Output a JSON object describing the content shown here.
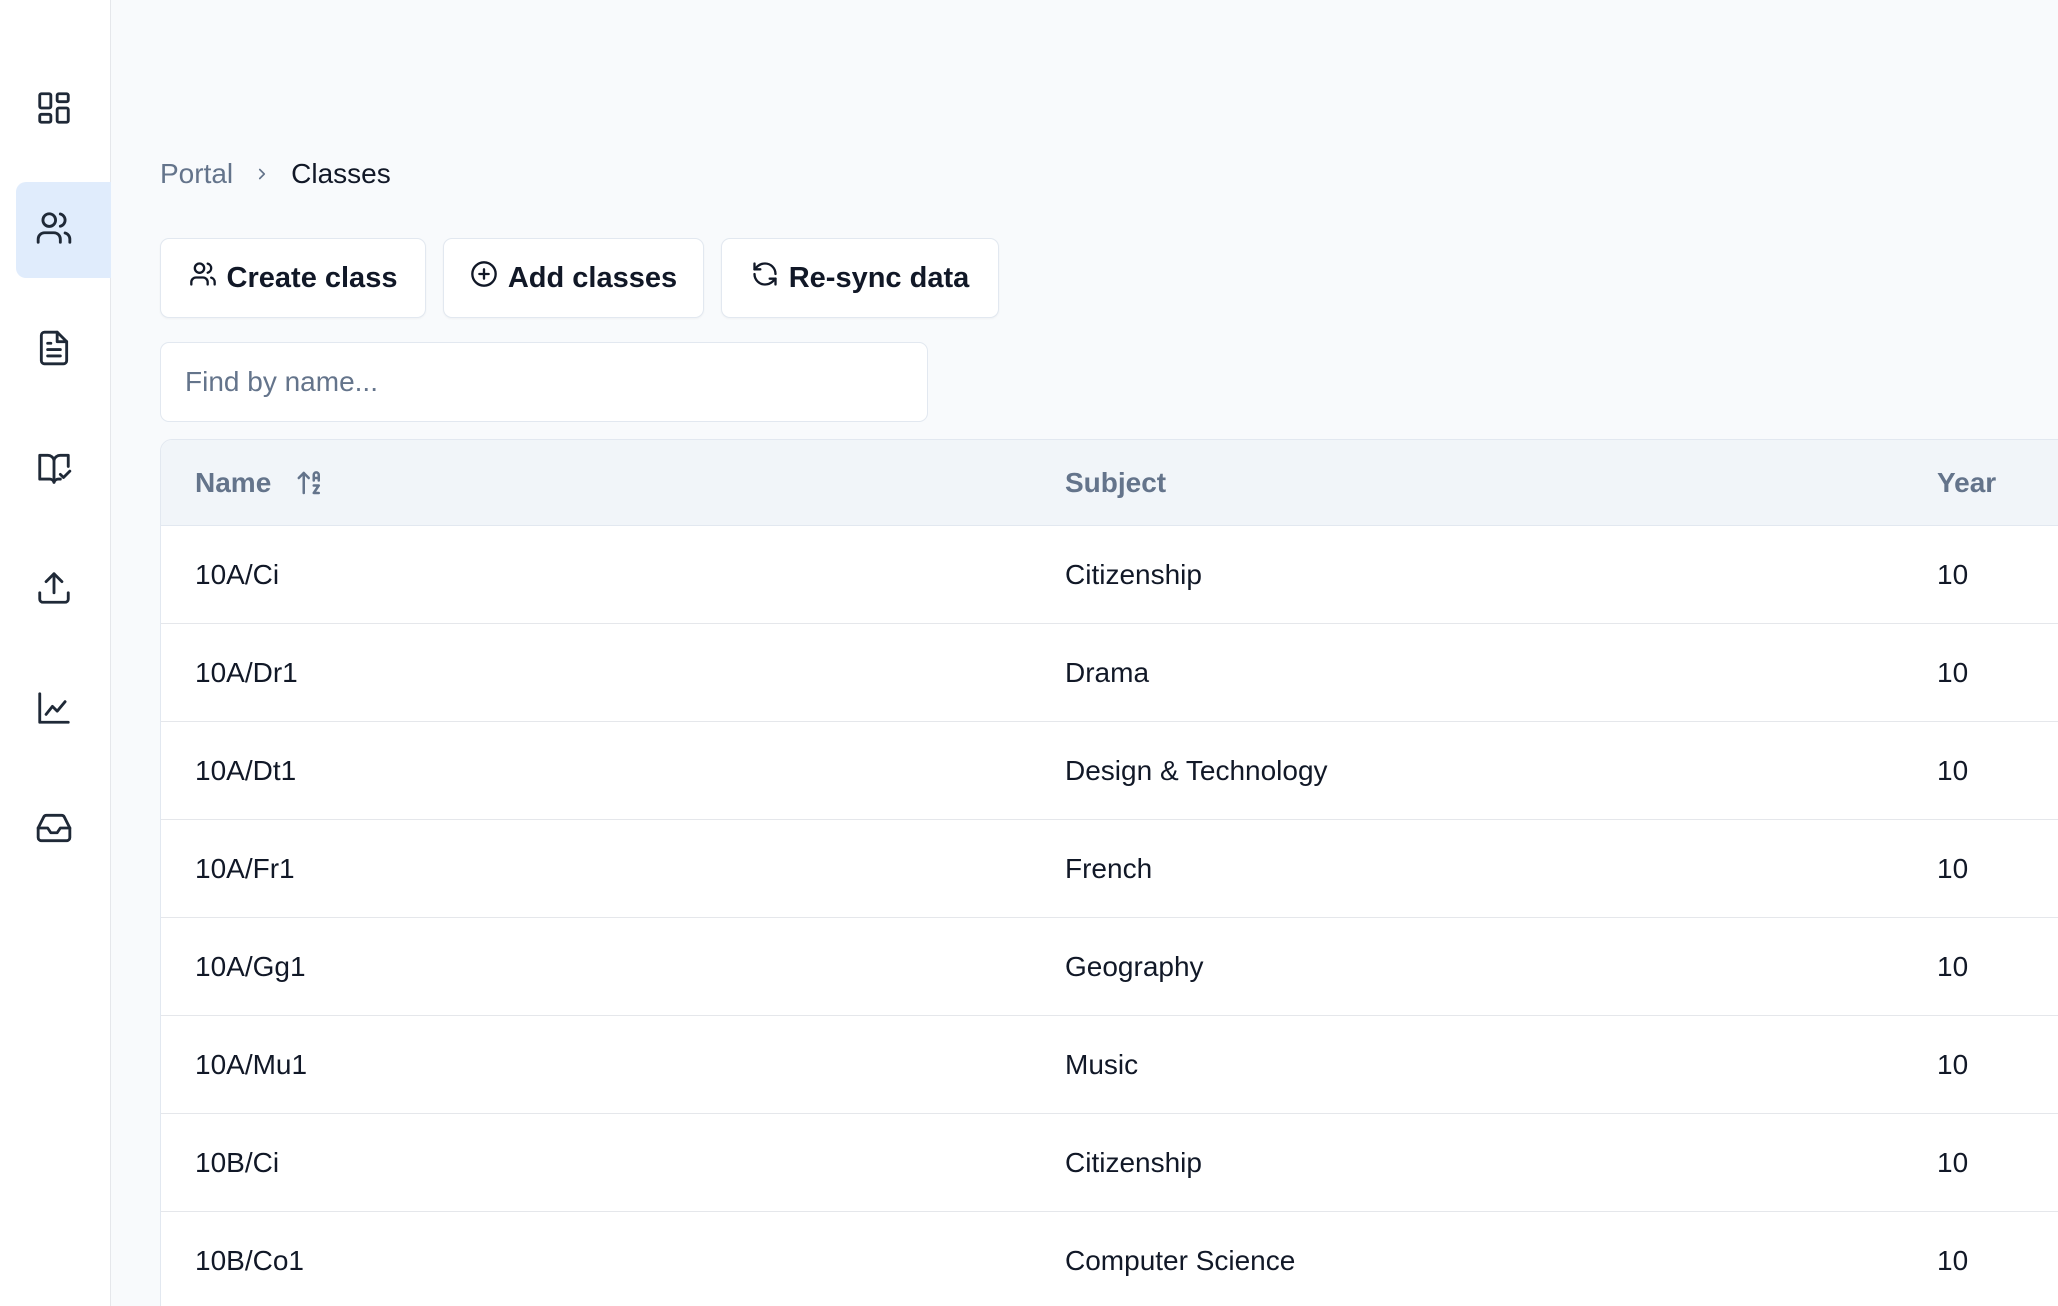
{
  "sidebar": {
    "items": [
      {
        "name": "dashboard",
        "icon": "dashboard-grid-icon",
        "active": false
      },
      {
        "name": "classes",
        "icon": "users-icon",
        "active": true
      },
      {
        "name": "documents",
        "icon": "document-icon",
        "active": false
      },
      {
        "name": "assessments",
        "icon": "book-check-icon",
        "active": false
      },
      {
        "name": "upload",
        "icon": "upload-icon",
        "active": false
      },
      {
        "name": "analytics",
        "icon": "line-chart-icon",
        "active": false
      },
      {
        "name": "inbox",
        "icon": "inbox-icon",
        "active": false
      }
    ],
    "active_color": "#e0ecfc"
  },
  "breadcrumb": {
    "parent": "Portal",
    "current": "Classes"
  },
  "toolbar": {
    "create_label": "Create class",
    "add_label": "Add classes",
    "resync_label": "Re-sync data"
  },
  "search": {
    "placeholder": "Find by name...",
    "value": ""
  },
  "table": {
    "headers": {
      "name": "Name",
      "subject": "Subject",
      "year": "Year"
    },
    "rows": [
      {
        "name": "10A/Ci",
        "subject": "Citizenship",
        "year": "10"
      },
      {
        "name": "10A/Dr1",
        "subject": "Drama",
        "year": "10"
      },
      {
        "name": "10A/Dt1",
        "subject": "Design & Technology",
        "year": "10"
      },
      {
        "name": "10A/Fr1",
        "subject": "French",
        "year": "10"
      },
      {
        "name": "10A/Gg1",
        "subject": "Geography",
        "year": "10"
      },
      {
        "name": "10A/Mu1",
        "subject": "Music",
        "year": "10"
      },
      {
        "name": "10B/Ci",
        "subject": "Citizenship",
        "year": "10"
      },
      {
        "name": "10B/Co1",
        "subject": "Computer Science",
        "year": "10"
      }
    ]
  }
}
